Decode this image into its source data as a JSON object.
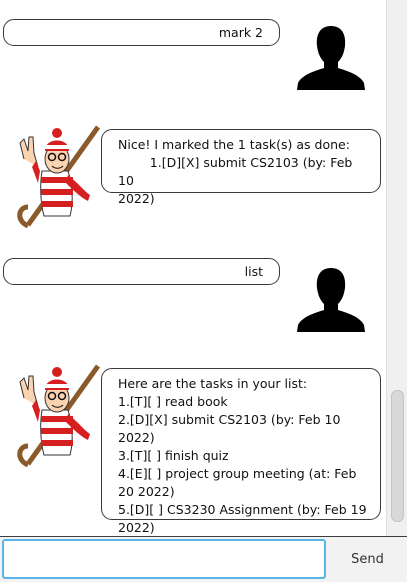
{
  "messages": [
    {
      "sender": "user",
      "text": "mark 2"
    },
    {
      "sender": "duke",
      "text": "Nice! I marked the 1 task(s) as done:\n        1.[D][X] submit CS2103 (by: Feb 10\n2022)"
    },
    {
      "sender": "user",
      "text": "list"
    },
    {
      "sender": "duke",
      "text": "Here are the tasks in your list:\n1.[T][ ] read book\n2.[D][X] submit CS2103 (by: Feb 10 2022)\n3.[T][ ] finish quiz\n4.[E][ ] project group meeting (at: Feb\n20 2022)\n5.[D][ ] CS3230 Assignment (by: Feb 19\n2022)"
    }
  ],
  "input": {
    "value": "",
    "placeholder": ""
  },
  "send_label": "Send",
  "colors": {
    "input_focus": "#5ab6e6",
    "bubble_border": "#3a3a3a"
  },
  "icons": {
    "user_avatar": "user-silhouette-icon",
    "duke_avatar": "waldo-avatar-icon"
  }
}
